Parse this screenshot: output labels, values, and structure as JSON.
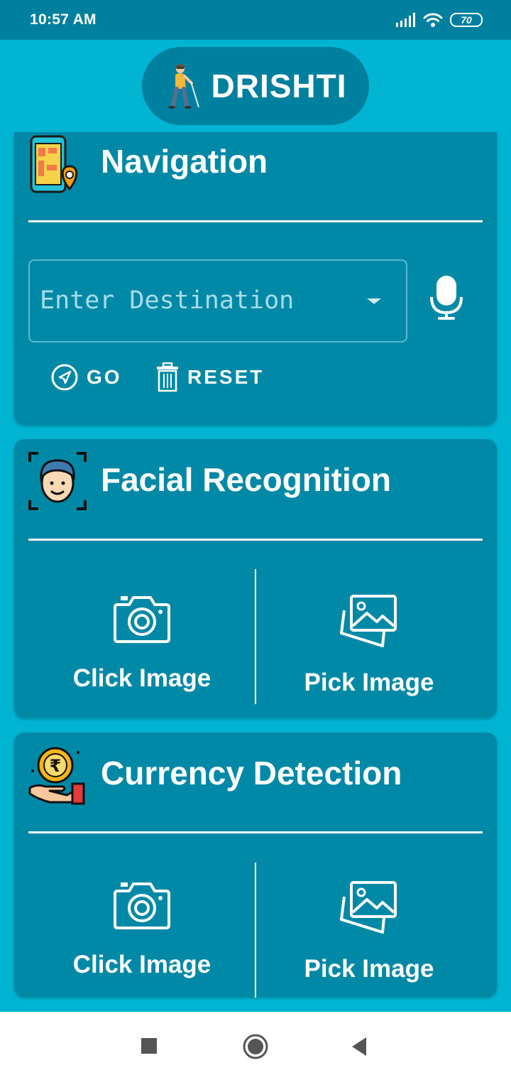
{
  "status_bar": {
    "time": "10:57 AM",
    "battery": "70"
  },
  "app": {
    "title": "DRISHTI"
  },
  "navigation": {
    "title": "Navigation",
    "destination_placeholder": "Enter Destination",
    "go_label": "GO",
    "reset_label": "RESET"
  },
  "facial_recognition": {
    "title": "Facial Recognition",
    "click_label": "Click Image",
    "pick_label": "Pick Image"
  },
  "currency_detection": {
    "title": "Currency Detection",
    "click_label": "Click Image",
    "pick_label": "Pick Image"
  },
  "colors": {
    "background": "#00b4d2",
    "card": "#0089a6",
    "status_bar": "#00809f",
    "text": "#ffffff"
  },
  "icons": {
    "status": [
      "signal-icon",
      "wifi-icon",
      "battery-icon"
    ],
    "app": "blind-person-icon",
    "navigation": "map-pin-icon",
    "facial_recognition": "face-scan-icon",
    "currency_detection": "rupee-coin-hand-icon",
    "option_click": "camera-icon",
    "option_pick": "gallery-icon",
    "system_nav": [
      "recents-square-icon",
      "home-circle-icon",
      "back-triangle-icon"
    ]
  }
}
